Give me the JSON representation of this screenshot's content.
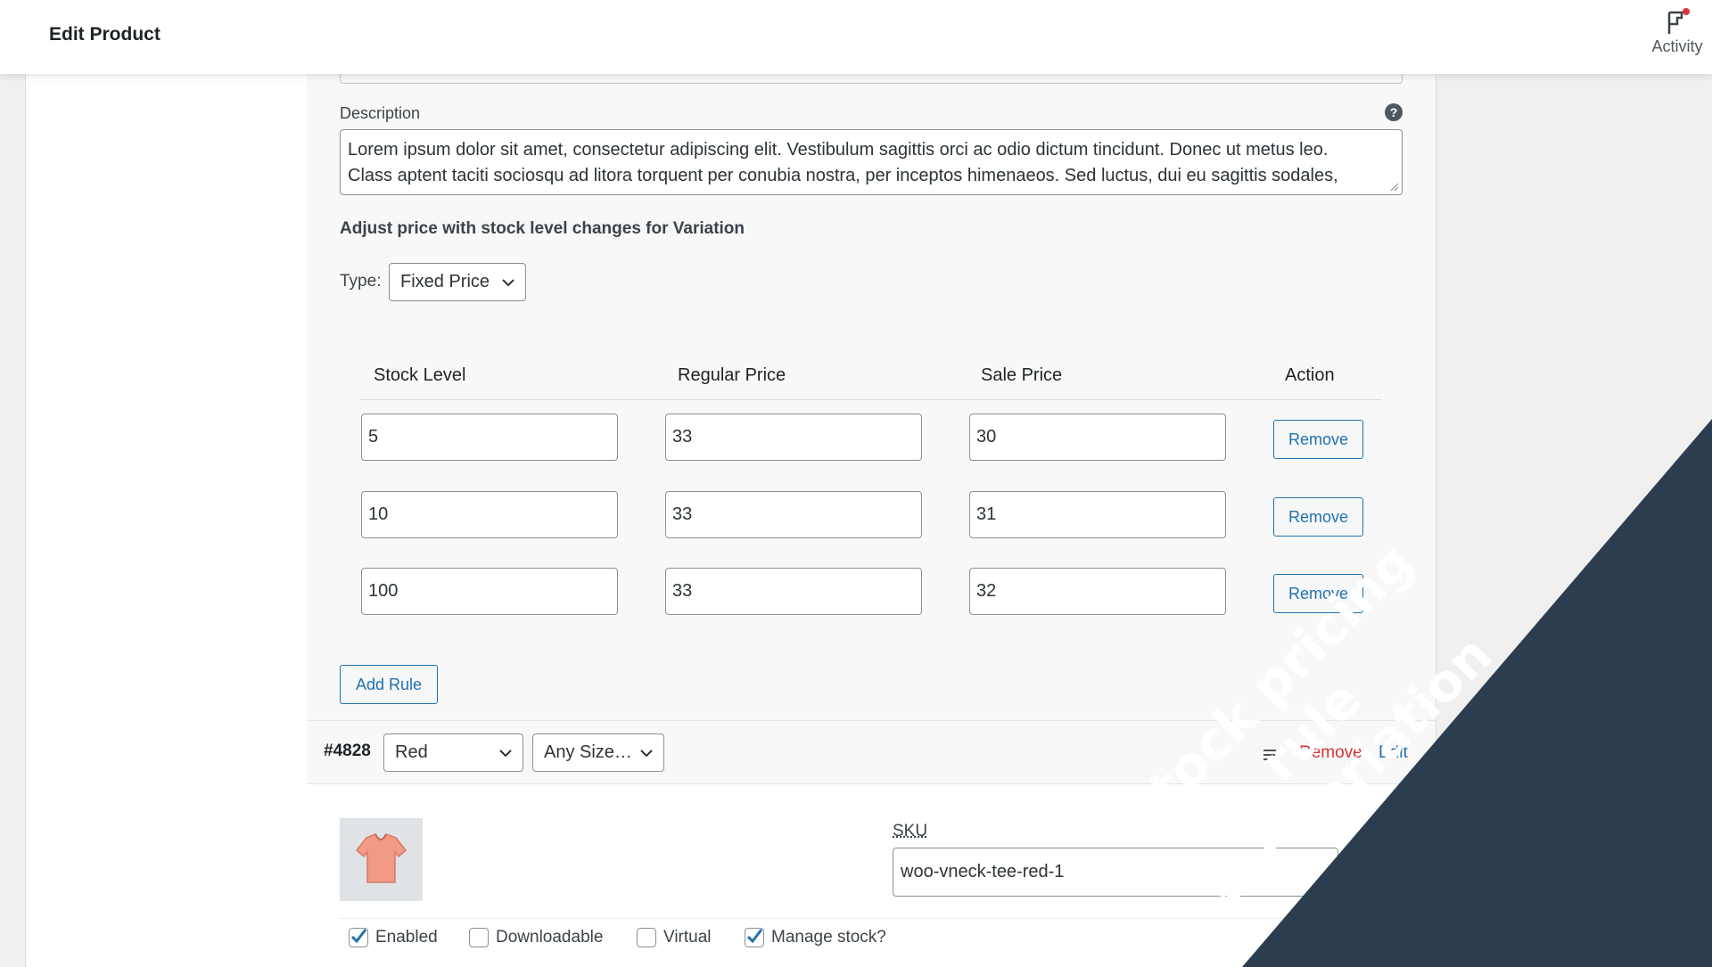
{
  "header": {
    "title": "Edit Product",
    "activity_label": "Activity"
  },
  "description": {
    "label": "Description",
    "help": "?",
    "line1": "Lorem ipsum dolor sit amet, consectetur adipiscing elit. Vestibulum sagittis orci ac odio dictum tincidunt. Donec ut metus leo.",
    "line2": "Class aptent taciti sociosqu ad litora torquent per conubia nostra, per inceptos himenaeos. Sed luctus, dui eu sagittis sodales,"
  },
  "pricing": {
    "heading": "Adjust price with stock level changes for Variation",
    "type_label": "Type:",
    "type_value": "Fixed Price",
    "columns": {
      "stock": "Stock Level",
      "regular": "Regular Price",
      "sale": "Sale Price",
      "action": "Action"
    },
    "rules": [
      {
        "stock": "5",
        "regular": "33",
        "sale": "30",
        "action": "Remove"
      },
      {
        "stock": "10",
        "regular": "33",
        "sale": "31",
        "action": "Remove"
      },
      {
        "stock": "100",
        "regular": "33",
        "sale": "32",
        "action": "Remove"
      }
    ],
    "add_rule": "Add Rule"
  },
  "variation": {
    "id": "#4828",
    "color": "Red",
    "size": "Any Size…",
    "remove": "Remove",
    "edit": "Edit",
    "sku_label": "SKU",
    "sku_value": "woo-vneck-tee-red-1",
    "options": [
      {
        "label": "Enabled",
        "checked": true
      },
      {
        "label": "Downloadable",
        "checked": false
      },
      {
        "label": "Virtual",
        "checked": false
      },
      {
        "label": "Manage stock?",
        "checked": true
      }
    ]
  },
  "banner": {
    "line1": "Stock pricing rule",
    "line2": "for variation"
  },
  "colors": {
    "accent": "#2271b1",
    "danger": "#d63638",
    "ribbon": "#2b3d4f"
  }
}
